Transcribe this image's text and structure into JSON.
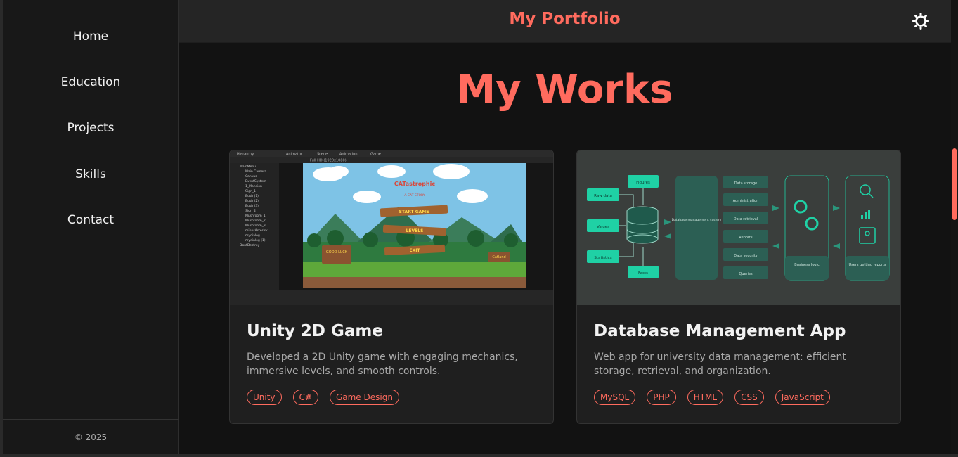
{
  "sidebar": {
    "items": [
      {
        "label": "Home"
      },
      {
        "label": "Education"
      },
      {
        "label": "Projects"
      },
      {
        "label": "Skills"
      },
      {
        "label": "Contact"
      }
    ],
    "footer": "© 2025"
  },
  "header": {
    "title": "My Portfolio",
    "theme_icon": "sun-icon"
  },
  "main": {
    "title": "My Works",
    "projects": [
      {
        "title": "Unity 2D Game",
        "description": "Developed a 2D Unity game with engaging mechanics, immersive levels, and smooth controls.",
        "tags": [
          "Unity",
          "C#",
          "Game Design"
        ],
        "image": {
          "game_title": "CATastrophic",
          "subtitle": "A CAT STORY",
          "menu": [
            "START GAME",
            "LEVELS",
            "EXIT"
          ],
          "sign_left": "GOOD LUCK",
          "sign_right": "Catland",
          "editor_tabs": [
            "Hierarchy",
            "Scene",
            "Animator",
            "Animation",
            "Game"
          ],
          "resolution": "Full HD (1920x1080)",
          "hierarchy": [
            "MainMenu",
            "Main Camera",
            "Canvas",
            "EventSystem",
            "1_Mansion",
            "Sign_1",
            "Bush (1)",
            "Bush (2)",
            "Bush (3)",
            "Sign_2",
            "Mushroom_1",
            "Mushroom_2",
            "Mushroom_3",
            "minusAsterisk",
            "mydialog",
            "mydialog (1)",
            "DontDestroy"
          ]
        }
      },
      {
        "title": "Database Management App",
        "description": "Web app for university data management: efficient storage, retrieval, and organization.",
        "tags": [
          "MySQL",
          "PHP",
          "HTML",
          "CSS",
          "JavaScript"
        ],
        "image": {
          "inputs": [
            "Raw data",
            "Values",
            "Statistics"
          ],
          "top_box": "Figures",
          "bottom_box": "Facts",
          "center": "Database management system",
          "functions": [
            "Data storage",
            "Administration",
            "Data retrieval",
            "Reports",
            "Data security",
            "Queries"
          ],
          "logic": "Business logic",
          "users": "Users getting reports"
        }
      }
    ]
  },
  "colors": {
    "accent": "#ff6b5e",
    "teal": "#1fd1a5",
    "background": "#121212"
  }
}
